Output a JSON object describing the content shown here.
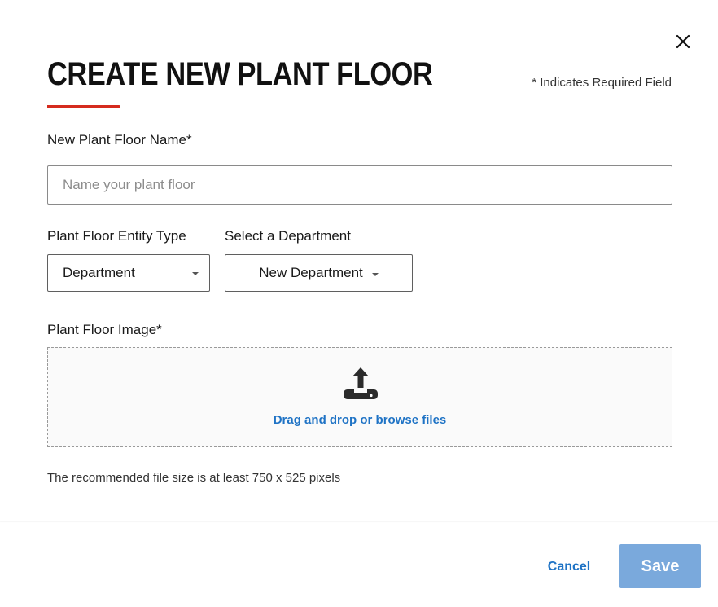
{
  "dialog": {
    "title": "CREATE NEW PLANT FLOOR",
    "required_note": "* Indicates Required Field",
    "close_icon": "close-icon"
  },
  "form": {
    "name_label": "New Plant Floor Name*",
    "name_placeholder": "Name your plant floor",
    "name_value": "",
    "entity_type_label": "Plant Floor Entity Type",
    "entity_type_selected": "Department",
    "department_label": "Select a Department",
    "department_selected": "New Department",
    "image_label": "Plant Floor Image*",
    "upload_icon": "upload-icon",
    "upload_link": "Drag and drop or browse files",
    "file_hint": "The recommended file size is at least 750 x 525 pixels"
  },
  "footer": {
    "cancel_label": "Cancel",
    "save_label": "Save"
  },
  "colors": {
    "accent_red": "#d52b1e",
    "link_blue": "#1f73c5",
    "save_button_disabled": "#7aa9dc"
  }
}
